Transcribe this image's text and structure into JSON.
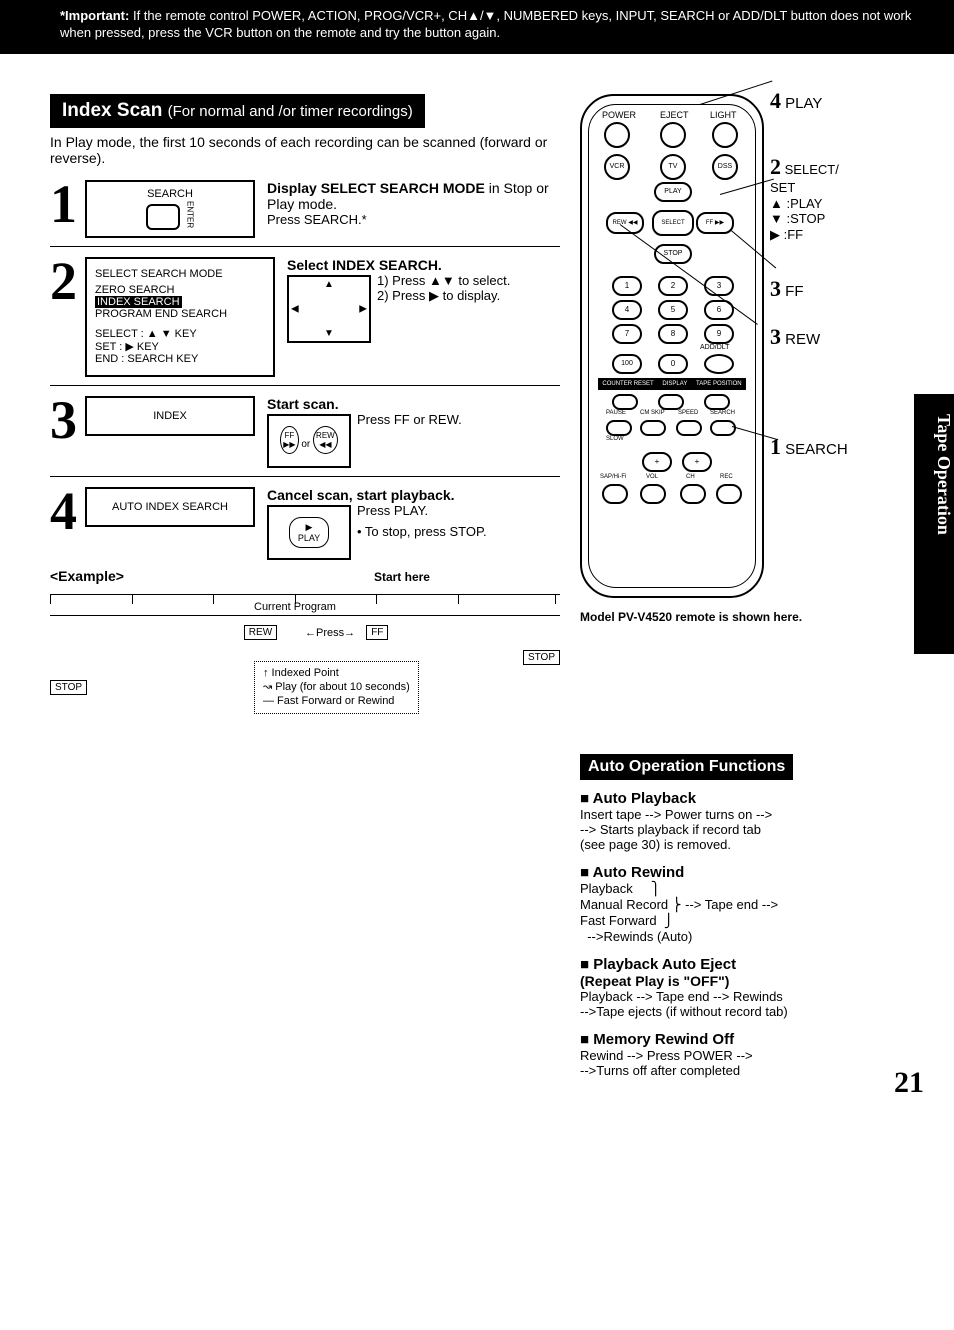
{
  "banner": {
    "lead": "*Important:",
    "text": "If the remote control POWER, ACTION, PROG/VCR+, CH▲/▼, NUMBERED keys, INPUT, SEARCH or ADD/DLT button does not work when pressed, press the VCR button on the remote and try the button again."
  },
  "side_tab": "Tape Operation",
  "section_title": "Index Scan",
  "section_paren": "(For normal and /or timer recordings)",
  "intro": "In Play mode, the first 10 seconds of each recording can be scanned (forward or reverse).",
  "steps": [
    {
      "num": "1",
      "display": {
        "title": "SEARCH",
        "note": "ENTER"
      },
      "head_strong": "Display SELECT SEARCH MODE",
      "head_rest": " in Stop or Play mode.",
      "sub": "Press SEARCH.*"
    },
    {
      "num": "2",
      "osd": {
        "title": "SELECT SEARCH MODE",
        "lines": [
          "ZERO SEARCH",
          "INDEX SEARCH",
          "PROGRAM END SEARCH"
        ],
        "selected_index": 1,
        "footer": [
          "SELECT : ▲ ▼ KEY",
          "SET      : ▶ KEY",
          "END     : SEARCH KEY"
        ]
      },
      "head_strong": "Select INDEX SEARCH.",
      "sub_lines": [
        "1) Press ▲▼ to select.",
        "2) Press ▶ to display."
      ],
      "mini_box": "dpad-diagram"
    },
    {
      "num": "3",
      "display_simple": "INDEX",
      "head_strong": "Start scan.",
      "sub_right": "Press FF or REW.",
      "mini_box_text": "FF ▶▶  or  REW ◀◀"
    },
    {
      "num": "4",
      "display_simple": "AUTO INDEX SEARCH",
      "head_strong": "Cancel scan, start playback.",
      "sub": "Press PLAY.",
      "bullet": "• To stop, press STOP.",
      "mini_box_text": "▶ PLAY"
    }
  ],
  "example": {
    "label": "<Example>",
    "start_here": "Start here",
    "current_program": "Current   Program",
    "rew": "REW",
    "ff": "FF",
    "press": "Press",
    "stop": "STOP",
    "legend": [
      "↑  Indexed Point",
      "↝ Play (for about 10 seconds)",
      "— Fast Forward or Rewind"
    ]
  },
  "remote": {
    "top_row": [
      "POWER",
      "EJECT",
      "LIGHT"
    ],
    "row2": [
      "VCR",
      "TV",
      "DSS"
    ],
    "dpad": {
      "up": "PLAY",
      "down": "STOP",
      "left": "REW ◀◀",
      "right": "FF ▶▶",
      "center": "SELECT"
    },
    "numpad": [
      "1",
      "2",
      "3",
      "4",
      "5",
      "6",
      "7",
      "8",
      "9",
      "100",
      "0"
    ],
    "add_dlt": "ADD/DLT",
    "strip": [
      "COUNTER RESET",
      "DISPLAY",
      "TAPE POSITION"
    ],
    "row_small1": [
      "PAUSE",
      "CM SKIP",
      "SPEED",
      "SEARCH"
    ],
    "slow": "SLOW",
    "bottom_row1": [
      "+",
      "+"
    ],
    "bottom_labels": [
      "SAP/Hi-Fi",
      "VOL",
      "CH",
      "REC"
    ],
    "callouts": [
      {
        "n": "4",
        "label": "PLAY"
      },
      {
        "n": "2",
        "label": "SELECT/\nSET\n▲ :PLAY\n▼ :STOP\n▶ :FF"
      },
      {
        "n": "3",
        "label": "FF"
      },
      {
        "n": "3",
        "label": "REW"
      },
      {
        "n": "1",
        "label": "SEARCH"
      }
    ],
    "model_note": "Model PV-V4520 remote is shown here."
  },
  "auto": {
    "title": "Auto Operation Functions",
    "items": [
      {
        "h": "Auto Playback",
        "body": "Insert tape --> Power turns on -->\n--> Starts playback if record tab\n(see page 30) is removed."
      },
      {
        "h": "Auto Rewind",
        "body": "Playback     ⎫\nManual Record ⎬ --> Tape end -->\nFast Forward  ⎭\n  -->Rewinds (Auto)"
      },
      {
        "h": "Playback Auto Eject",
        "subh": "(Repeat Play is \"OFF\")",
        "body": "Playback --> Tape end --> Rewinds\n  -->Tape ejects (if without record tab)"
      },
      {
        "h": "Memory Rewind Off",
        "body": "Rewind --> Press POWER -->\n  -->Turns off after completed"
      }
    ]
  },
  "page_number": "21"
}
